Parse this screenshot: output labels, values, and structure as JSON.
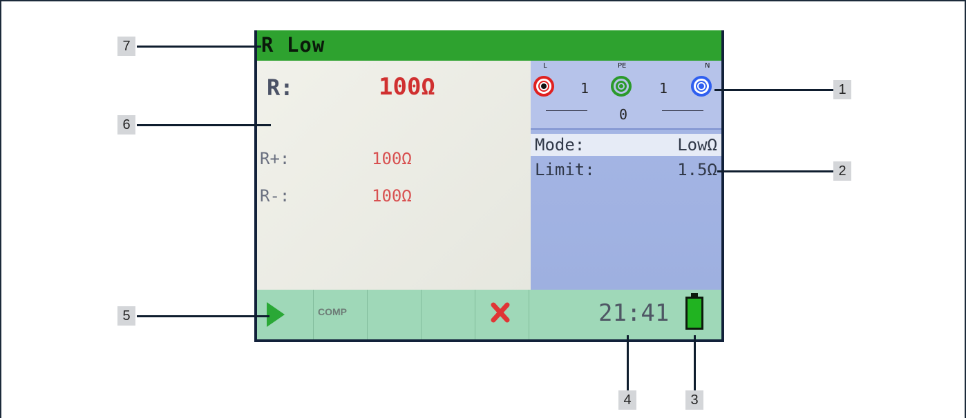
{
  "screen": {
    "title": "R Low",
    "results": {
      "main": {
        "label": "R:",
        "value": "100Ω"
      },
      "plus": {
        "label": "R+:",
        "value": "100Ω"
      },
      "minus": {
        "label": "R-:",
        "value": "100Ω"
      }
    },
    "terminals": [
      {
        "name": "L",
        "color": "#e02020"
      },
      {
        "name": "PE",
        "color": "#2b9a2b"
      },
      {
        "name": "N",
        "color": "#2f5ff0"
      }
    ],
    "terminal_counts": {
      "left": "1",
      "right": "1",
      "bottom": "0"
    },
    "settings": {
      "mode": {
        "label": "Mode:",
        "value": "LowΩ"
      },
      "limit": {
        "label": "Limit:",
        "value": "1.5Ω"
      }
    },
    "softkeys": {
      "comp": "COMP"
    },
    "status": {
      "time": "21:41"
    }
  },
  "callouts": [
    "1",
    "2",
    "3",
    "4",
    "5",
    "6",
    "7"
  ]
}
